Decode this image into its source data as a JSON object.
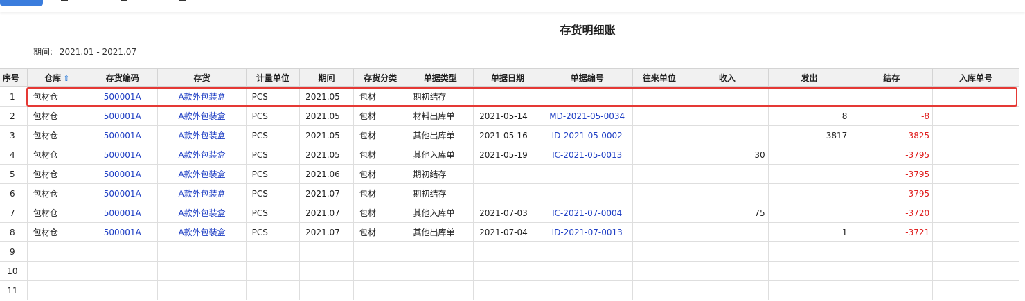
{
  "report": {
    "title": "存货明细账",
    "period_label": "期间:",
    "period_value": "2021.01 - 2021.07"
  },
  "columns": [
    "序号",
    "仓库",
    "存货编码",
    "存货",
    "计量单位",
    "期间",
    "存货分类",
    "单据类型",
    "单据日期",
    "单据编号",
    "往来单位",
    "收入",
    "发出",
    "结存",
    "入库单号"
  ],
  "rows": [
    {
      "no": "1",
      "wh": "包材仓",
      "code": "500001A",
      "item": "A款外包装盒",
      "unit": "PCS",
      "period": "2021.05",
      "cat": "包材",
      "type": "期初结存",
      "date": "",
      "docno": "",
      "partner": "",
      "in": "",
      "out": "",
      "bal": "",
      "inno": ""
    },
    {
      "no": "2",
      "wh": "包材仓",
      "code": "500001A",
      "item": "A款外包装盒",
      "unit": "PCS",
      "period": "2021.05",
      "cat": "包材",
      "type": "材料出库单",
      "date": "2021-05-14",
      "docno": "MD-2021-05-0034",
      "partner": "",
      "in": "",
      "out": "8",
      "bal": "-8",
      "inno": ""
    },
    {
      "no": "3",
      "wh": "包材仓",
      "code": "500001A",
      "item": "A款外包装盒",
      "unit": "PCS",
      "period": "2021.05",
      "cat": "包材",
      "type": "其他出库单",
      "date": "2021-05-16",
      "docno": "ID-2021-05-0002",
      "partner": "",
      "in": "",
      "out": "3817",
      "bal": "-3825",
      "inno": ""
    },
    {
      "no": "4",
      "wh": "包材仓",
      "code": "500001A",
      "item": "A款外包装盒",
      "unit": "PCS",
      "period": "2021.05",
      "cat": "包材",
      "type": "其他入库单",
      "date": "2021-05-19",
      "docno": "IC-2021-05-0013",
      "partner": "",
      "in": "30",
      "out": "",
      "bal": "-3795",
      "inno": ""
    },
    {
      "no": "5",
      "wh": "包材仓",
      "code": "500001A",
      "item": "A款外包装盒",
      "unit": "PCS",
      "period": "2021.06",
      "cat": "包材",
      "type": "期初结存",
      "date": "",
      "docno": "",
      "partner": "",
      "in": "",
      "out": "",
      "bal": "-3795",
      "inno": ""
    },
    {
      "no": "6",
      "wh": "包材仓",
      "code": "500001A",
      "item": "A款外包装盒",
      "unit": "PCS",
      "period": "2021.07",
      "cat": "包材",
      "type": "期初结存",
      "date": "",
      "docno": "",
      "partner": "",
      "in": "",
      "out": "",
      "bal": "-3795",
      "inno": ""
    },
    {
      "no": "7",
      "wh": "包材仓",
      "code": "500001A",
      "item": "A款外包装盒",
      "unit": "PCS",
      "period": "2021.07",
      "cat": "包材",
      "type": "其他入库单",
      "date": "2021-07-03",
      "docno": "IC-2021-07-0004",
      "partner": "",
      "in": "75",
      "out": "",
      "bal": "-3720",
      "inno": ""
    },
    {
      "no": "8",
      "wh": "包材仓",
      "code": "500001A",
      "item": "A款外包装盒",
      "unit": "PCS",
      "period": "2021.07",
      "cat": "包材",
      "type": "其他出库单",
      "date": "2021-07-04",
      "docno": "ID-2021-07-0013",
      "partner": "",
      "in": "",
      "out": "1",
      "bal": "-3721",
      "inno": ""
    },
    {
      "no": "9",
      "wh": "",
      "code": "",
      "item": "",
      "unit": "",
      "period": "",
      "cat": "",
      "type": "",
      "date": "",
      "docno": "",
      "partner": "",
      "in": "",
      "out": "",
      "bal": "",
      "inno": ""
    },
    {
      "no": "10",
      "wh": "",
      "code": "",
      "item": "",
      "unit": "",
      "period": "",
      "cat": "",
      "type": "",
      "date": "",
      "docno": "",
      "partner": "",
      "in": "",
      "out": "",
      "bal": "",
      "inno": ""
    },
    {
      "no": "11",
      "wh": "",
      "code": "",
      "item": "",
      "unit": "",
      "period": "",
      "cat": "",
      "type": "",
      "date": "",
      "docno": "",
      "partner": "",
      "in": "",
      "out": "",
      "bal": "",
      "inno": ""
    }
  ],
  "colors": {
    "link": "#1f3fc4",
    "negative": "#e02020",
    "highlight": "#e53935",
    "accent": "#3b7ddd"
  },
  "icons": {
    "sort": "sort-arrow-icon"
  }
}
